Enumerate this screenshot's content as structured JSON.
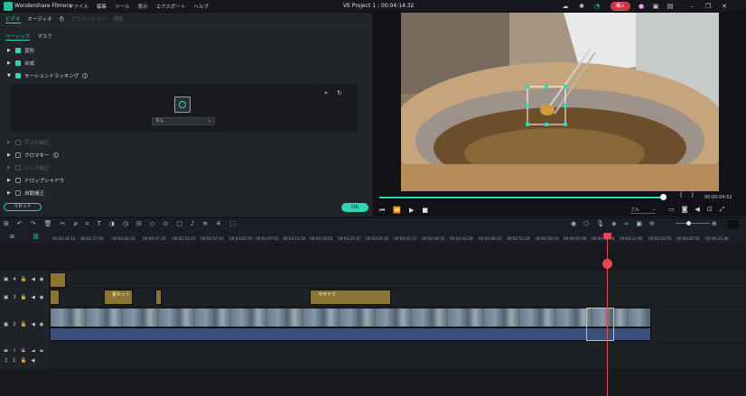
{
  "titlebar": {
    "app_name": "Wondershare Filmora",
    "menu": [
      "ファイル",
      "編集",
      "ツール",
      "表示",
      "エクスポート",
      "ヘルプ"
    ],
    "project": "VE Project 1 : 00:04:14:32",
    "buy_label": "購入"
  },
  "panel": {
    "tabs": [
      "ビデオ",
      "オーディオ",
      "色",
      "アニメーション",
      "速度"
    ],
    "subtabs": [
      "ベーシック",
      "マスク"
    ],
    "sections": [
      {
        "label": "変形",
        "checked": true,
        "enabled": true
      },
      {
        "label": "合成",
        "checked": true,
        "enabled": true
      },
      {
        "label": "モーショントラッキング",
        "checked": true,
        "enabled": true
      }
    ],
    "tracking_select": "なし",
    "lower_sections": [
      {
        "label": "手ぶれ補正",
        "enabled": false
      },
      {
        "label": "クロマキー",
        "enabled": true
      },
      {
        "label": "レンズ補正",
        "enabled": false
      },
      {
        "label": "ドロップシャドウ",
        "enabled": true
      },
      {
        "label": "自動補正",
        "enabled": true
      }
    ],
    "reset_label": "リセット",
    "ok_label": "OK"
  },
  "preview": {
    "timecode": "00:00:04:52",
    "progress": 0.99,
    "zoom": "フル"
  },
  "timeline": {
    "ruler": [
      "00:00:00:00",
      "00:02:34:14",
      "00:02:37:29",
      "00:02:42:24",
      "00:02:47:20",
      "00:02:52:15",
      "00:02:57:10",
      "00:03:02:05",
      "00:03:07:01",
      "00:03:11:56",
      "00:03:16:51",
      "00:03:21:47",
      "00:03:26:42",
      "00:03:31:37",
      "00:03:36:32",
      "00:03:41:28",
      "00:03:46:23",
      "00:03:51:18",
      "00:03:56:14",
      "00:04:01:09",
      "00:04:06:04",
      "00:04:11:00",
      "00:04:15:55",
      "00:04:20:50",
      "00:04:25:46"
    ],
    "tracks": [
      {
        "id": "4"
      },
      {
        "id": "3"
      },
      {
        "id": "2"
      },
      {
        "id": "1"
      },
      {
        "id": "1"
      }
    ],
    "clips": {
      "title_a": "夏セット",
      "title_b": "モザイク"
    }
  }
}
